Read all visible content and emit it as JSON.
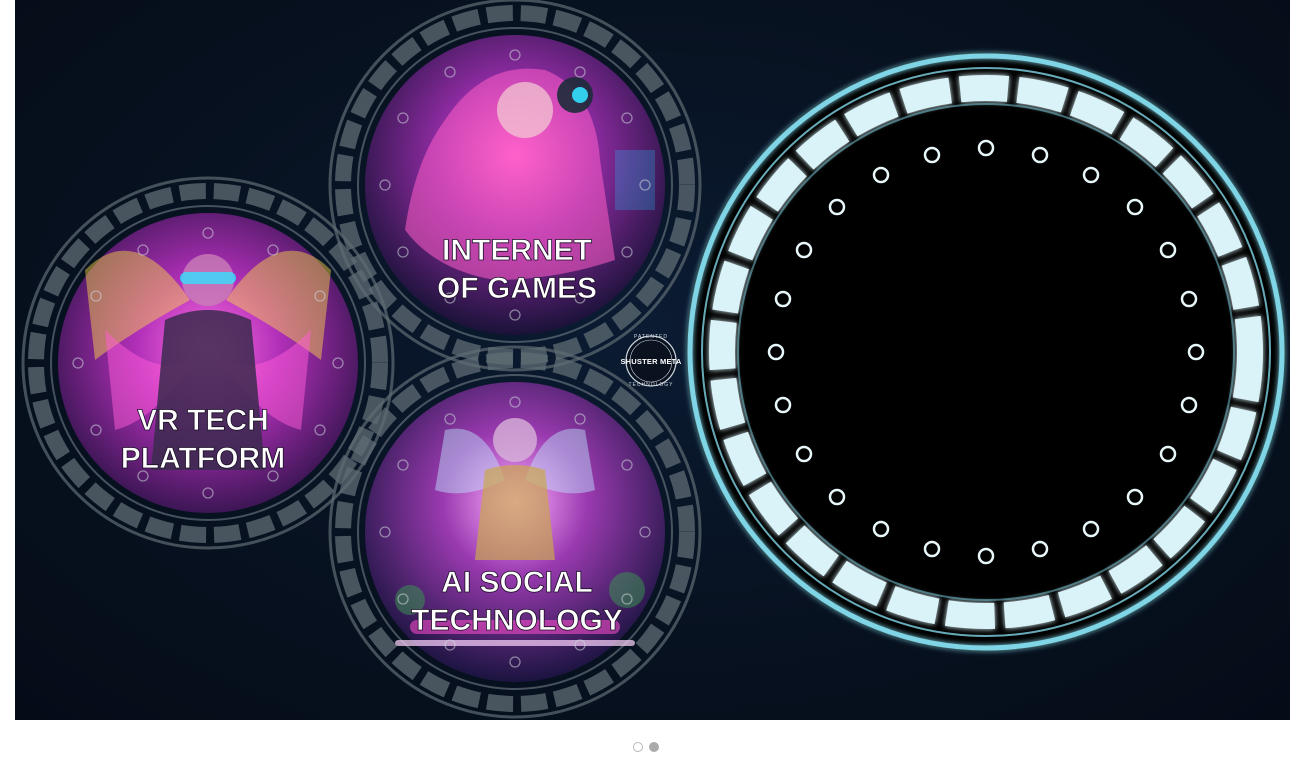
{
  "tiles": [
    {
      "line1": "INTERNET",
      "line2": "OF GAMES",
      "hue": "#c2338f"
    },
    {
      "line1": "VR TECH",
      "line2": "PLATFORM",
      "hue": "#a020c0"
    },
    {
      "line1": "AI SOCIAL",
      "line2": "TECHNOLOGY",
      "hue": "#7a2fb0"
    }
  ],
  "badge": {
    "top": "PATENTED",
    "name": "SHUSTER META",
    "bottom": "TECHNOLOGY"
  },
  "pager": {
    "active_index": 1,
    "count": 2
  },
  "colors": {
    "background": "#07111f",
    "ring_glow": "#7fd4e6",
    "ring_dim": "#6f7d86",
    "pink": "#ff4fd0",
    "cyan": "#35e0ff"
  }
}
